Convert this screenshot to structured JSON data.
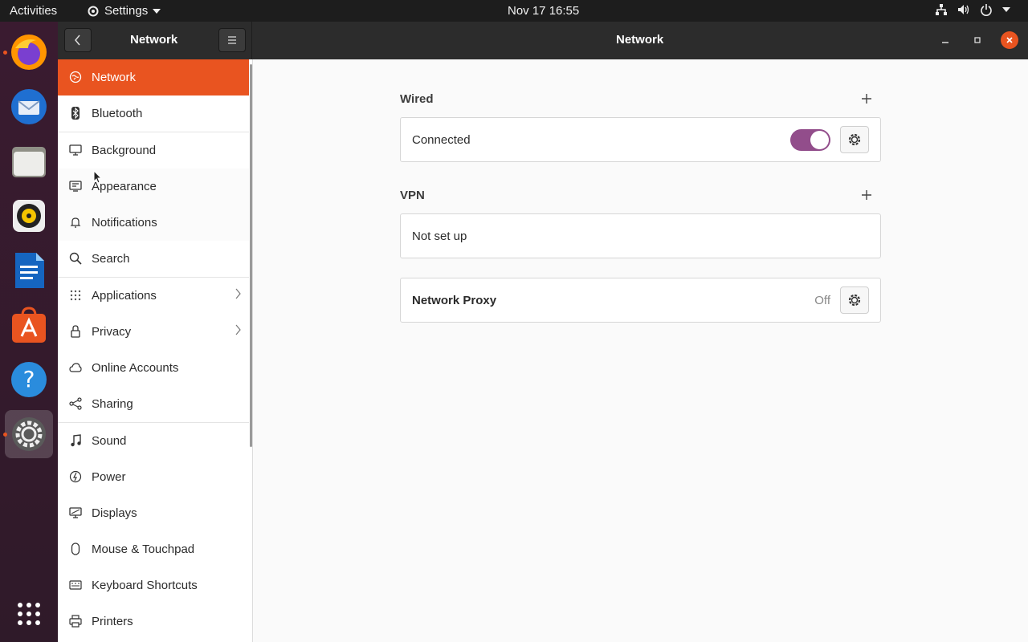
{
  "topbar": {
    "activities": "Activities",
    "app_menu": "Settings",
    "clock": "Nov 17  16:55"
  },
  "dock": {
    "apps": [
      {
        "name": "firefox",
        "running": true
      },
      {
        "name": "thunderbird",
        "running": false
      },
      {
        "name": "files",
        "running": false
      },
      {
        "name": "rhythmbox",
        "running": false
      },
      {
        "name": "libreoffice-writer",
        "running": false
      },
      {
        "name": "ubuntu-software",
        "running": false
      },
      {
        "name": "help",
        "running": false
      },
      {
        "name": "settings",
        "running": true,
        "active": true
      }
    ],
    "show_apps": "app-grid-icon"
  },
  "header": {
    "sidebar_title": "Network",
    "main_title": "Network"
  },
  "sidebar": {
    "items": [
      {
        "label": "Network",
        "icon": "network-icon",
        "selected": true
      },
      {
        "label": "Bluetooth",
        "icon": "bluetooth-icon"
      },
      {
        "label": "Background",
        "icon": "monitor-icon"
      },
      {
        "label": "Appearance",
        "icon": "appearance-icon"
      },
      {
        "label": "Notifications",
        "icon": "bell-icon"
      },
      {
        "label": "Search",
        "icon": "search-icon"
      },
      {
        "label": "Applications",
        "icon": "grid-icon",
        "chevron": true
      },
      {
        "label": "Privacy",
        "icon": "lock-icon",
        "chevron": true
      },
      {
        "label": "Online Accounts",
        "icon": "cloud-icon"
      },
      {
        "label": "Sharing",
        "icon": "share-icon"
      },
      {
        "label": "Sound",
        "icon": "music-note-icon"
      },
      {
        "label": "Power",
        "icon": "power-icon"
      },
      {
        "label": "Displays",
        "icon": "display-icon"
      },
      {
        "label": "Mouse & Touchpad",
        "icon": "mouse-icon"
      },
      {
        "label": "Keyboard Shortcuts",
        "icon": "keyboard-icon"
      },
      {
        "label": "Printers",
        "icon": "printer-icon"
      }
    ]
  },
  "main": {
    "wired": {
      "title": "Wired",
      "status": "Connected",
      "toggle_on": true
    },
    "vpn": {
      "title": "VPN",
      "status": "Not set up"
    },
    "proxy": {
      "label": "Network Proxy",
      "status": "Off"
    }
  },
  "colors": {
    "accent": "#e95420",
    "toggle": "#924d8b",
    "dock": "#2f1a29",
    "header": "#2c2c2c"
  }
}
